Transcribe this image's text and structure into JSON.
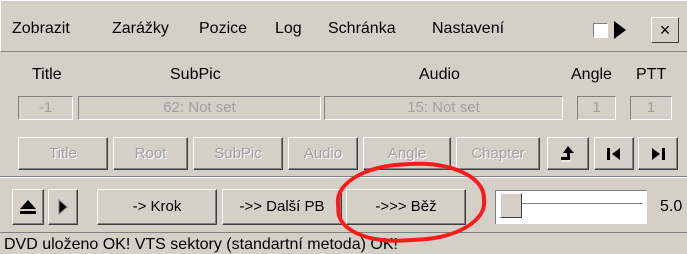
{
  "menu": {
    "items": [
      "Zobrazit",
      "Zarážky",
      "Pozice",
      "Log",
      "Schránka",
      "Nastavení"
    ],
    "close_label": "×"
  },
  "headers": {
    "title": "Title",
    "subpic": "SubPic",
    "audio": "Audio",
    "angle": "Angle",
    "ptt": "PTT"
  },
  "fields": {
    "title": "-1",
    "subpic": "62: Not set",
    "audio": "15: Not set",
    "angle": "1",
    "ptt": "1"
  },
  "nav_buttons": [
    "Title",
    "Root",
    "SubPic",
    "Audio",
    "Angle",
    "Chapter"
  ],
  "icons": {
    "up": "up-return-icon",
    "prev": "skip-back-icon",
    "next": "skip-forward-icon",
    "eject": "eject-icon",
    "play": "play-icon"
  },
  "controls": {
    "step": "-> Krok",
    "next_pb": "->> Další PB",
    "run": "->>> Běž",
    "zoom": "5.0"
  },
  "slider": {
    "level": 0.0
  },
  "status": "DVD uloženo OK!  VTS sektory (standartní metoda) OK!",
  "colors": {
    "window": "#d4d0c8",
    "disabled_text": "#a0a0a0",
    "annotation": "#ff1a1a"
  }
}
